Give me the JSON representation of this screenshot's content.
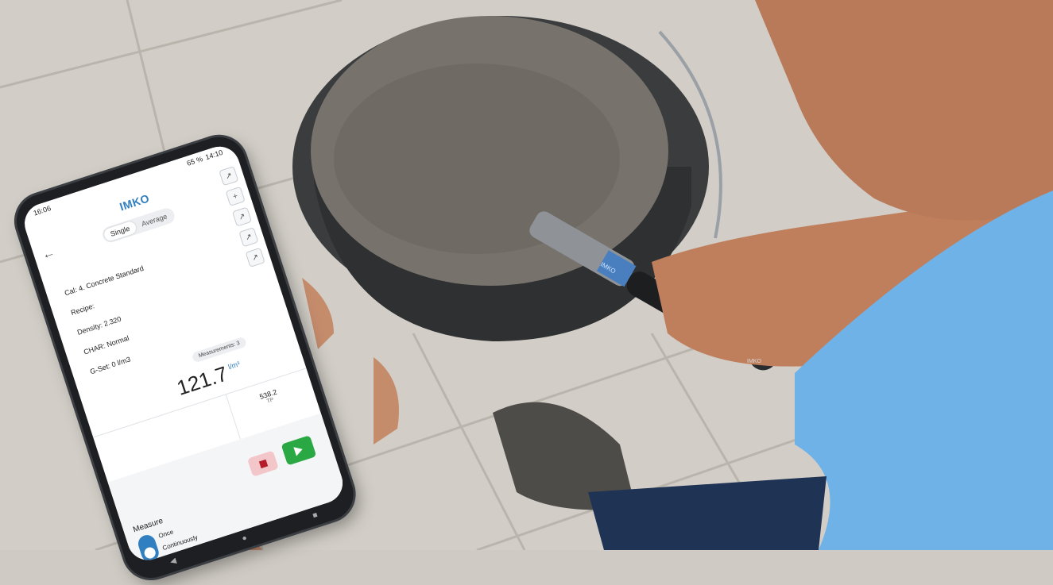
{
  "status": {
    "time": "16:06",
    "clock_right": "14:10",
    "battery": "65 %"
  },
  "app": {
    "logo": "IMKO",
    "back_icon": "arrow-left-icon",
    "segment_options": [
      "Single",
      "Average"
    ],
    "segment_selected": "Single",
    "toolbar_icons": [
      "export-icon",
      "add-icon",
      "export-icon",
      "export-icon",
      "export-icon"
    ]
  },
  "info": {
    "cal": "Cal: 4. Concrete Standard",
    "recipe": "Recipe:",
    "density": "Density: 2.320",
    "char": "CHAR: Normal",
    "gset": "G-Set: 0 l/m3"
  },
  "measurement": {
    "count_label": "Measurements: 3",
    "value": "121.7",
    "unit": "l/m³",
    "tp_value": "538.2",
    "tp_label": "TP"
  },
  "controls": {
    "measure_label": "Measure",
    "mode_once": "Once",
    "mode_continuously": "Continuously"
  },
  "device_labels": {
    "probe": "IMKO",
    "handle": "IMKO"
  },
  "colors": {
    "accent": "#2f7fc1",
    "play": "#2aa843",
    "stop": "#b21f2b"
  }
}
